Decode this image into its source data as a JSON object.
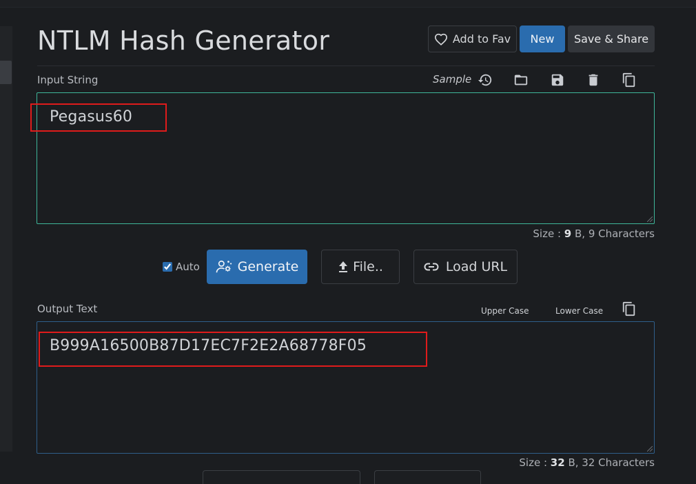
{
  "page": {
    "title": "NTLM Hash Generator"
  },
  "header": {
    "fav_label": "Add to Fav",
    "new_label": "New",
    "save_label": "Save & Share"
  },
  "input": {
    "label": "Input String",
    "sample_label": "Sample",
    "value": "Pegasus60",
    "size_prefix": "Size : ",
    "size_value": "9",
    "size_suffix": " B, 9 Characters"
  },
  "actions": {
    "auto_label": "Auto",
    "auto_checked": true,
    "generate_label": "Generate",
    "file_label": "File..",
    "load_url_label": "Load URL"
  },
  "output": {
    "label": "Output Text",
    "upper_case_label": "Upper Case",
    "lower_case_label": "Lower Case",
    "value": "B999A16500B87D17EC7F2E2A68778F05",
    "size_prefix": "Size : ",
    "size_value": "32",
    "size_suffix": " B, 32 Characters"
  },
  "icons": {
    "fav": "heart-outline-icon",
    "history": "history-icon",
    "open": "folder-icon",
    "save": "save-icon",
    "delete": "trash-icon",
    "copy": "copy-icon",
    "generate": "user-cog-icon",
    "file": "upload-icon",
    "url": "link-icon"
  },
  "colors": {
    "background": "#1b1d20",
    "primary": "#2a6cae",
    "input_border": "#3fb79b",
    "output_border": "#2f5f8b",
    "highlight": "#e01b1b"
  }
}
